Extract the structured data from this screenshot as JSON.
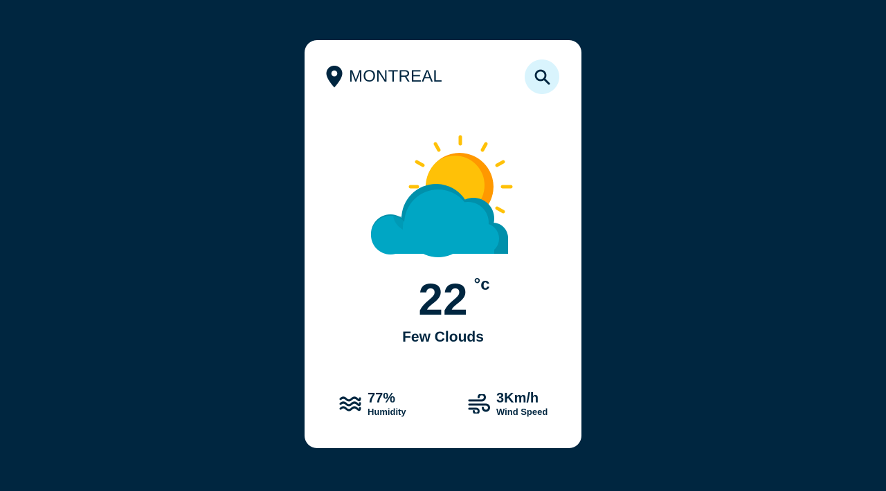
{
  "location": {
    "city": "MONTREAL",
    "icon": "map-pin-icon"
  },
  "search": {
    "icon": "search-icon"
  },
  "weather": {
    "icon": "few-clouds-icon",
    "temperature": "22",
    "unit": "°c",
    "condition": "Few Clouds"
  },
  "stats": {
    "humidity": {
      "icon": "humidity-waves-icon",
      "value": "77%",
      "label": "Humidity"
    },
    "wind": {
      "icon": "wind-icon",
      "value": "3Km/h",
      "label": "Wind Speed"
    }
  },
  "colors": {
    "background": "#002640",
    "card": "#ffffff",
    "text": "#002640",
    "search_bg": "#d9f4fd",
    "sun": "#ffc107",
    "sun_shade": "#ff9800",
    "cloud": "#00a6c4",
    "cloud_shade": "#0090ab"
  }
}
